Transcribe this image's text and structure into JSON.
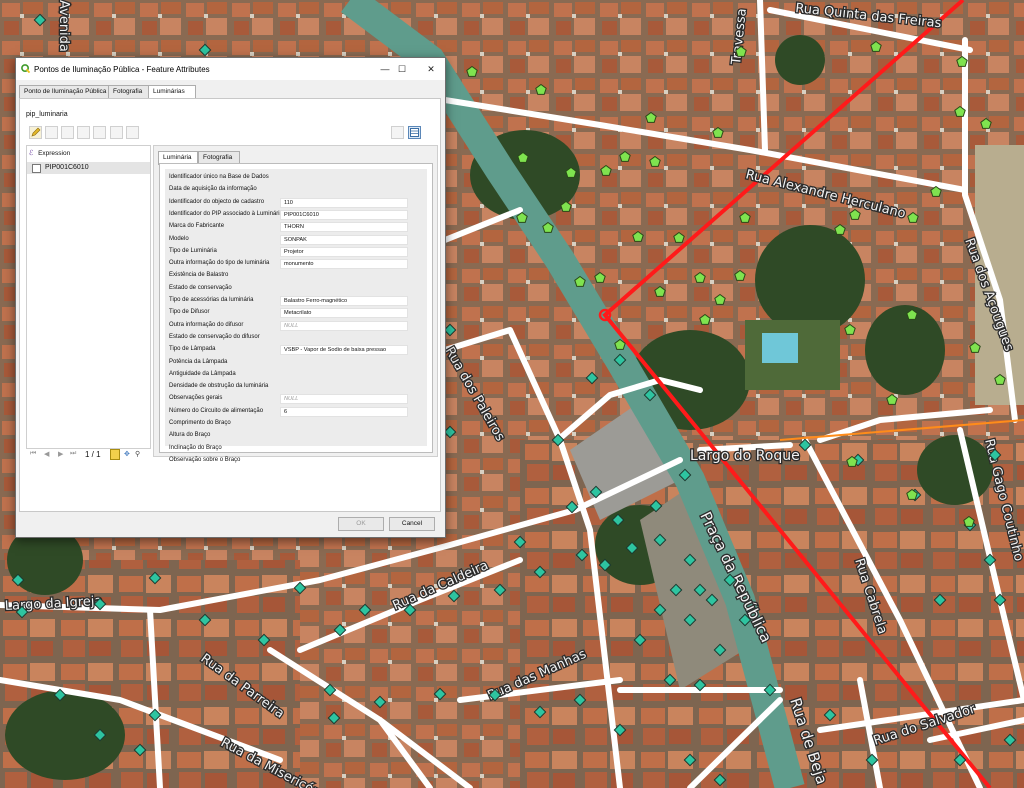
{
  "window": {
    "title": "Pontos de Iluminação Pública - Feature Attributes",
    "minimize": "—",
    "maximize": "☐",
    "close": "✕"
  },
  "tabs": [
    {
      "label": "Ponto de Iluminação Pública"
    },
    {
      "label": "Fotografia"
    },
    {
      "label": "Luminárias",
      "active": true
    }
  ],
  "layer_name": "pip_luminaria",
  "left_pane": {
    "expression_label": "Expression",
    "features": [
      "PIP001C6010"
    ]
  },
  "navigation": {
    "counter": "1 / 1"
  },
  "inner_tabs": [
    {
      "label": "Luminária",
      "active": true
    },
    {
      "label": "Fotografia"
    }
  ],
  "fields": [
    {
      "label": "Identificador único na Base de Dados",
      "value": null
    },
    {
      "label": "Data de aquisição da informação",
      "value": null
    },
    {
      "label": "Identificador do objecto de cadastro",
      "value": "110"
    },
    {
      "label": "Identificador do PIP associado à Luminária",
      "value": "PIP001C6010"
    },
    {
      "label": "Marca do Fabricante",
      "value": "THORN"
    },
    {
      "label": "Modelo",
      "value": "SONPAK"
    },
    {
      "label": "Tipo de Luminária",
      "value": "Projetor"
    },
    {
      "label": "Outra informação do tipo de luminária",
      "value": "monumento"
    },
    {
      "label": "Existência de Balastro",
      "value": null
    },
    {
      "label": "Estado de conservação",
      "value": null
    },
    {
      "label": "Tipo de acessórias da luminária",
      "value": "Balastro Ferro-magnético"
    },
    {
      "label": "Tipo de Difusor",
      "value": "Metacrilato"
    },
    {
      "label": "Outra informação do difusor",
      "value": "NULL"
    },
    {
      "label": "Estado de conservação do difusor",
      "value": null
    },
    {
      "label": "Tipo de Lâmpada",
      "value": "VSBP - Vapor de Sodio de baixa pressao"
    },
    {
      "label": "Potência da Lâmpada",
      "value": null
    },
    {
      "label": "Antiguidade da Lâmpada",
      "value": null
    },
    {
      "label": "Densidade de obstrução da luminária",
      "value": null
    },
    {
      "label": "Observações gerais",
      "value": "NULL"
    },
    {
      "label": "Número do Circuito de alimentação",
      "value": "6"
    },
    {
      "label": "Comprimento do Braço",
      "value": null
    },
    {
      "label": "Altura do Braço",
      "value": null
    },
    {
      "label": "Inclinação do Braço",
      "value": null
    },
    {
      "label": "Observação sobre o Braço",
      "value": null
    }
  ],
  "buttons": {
    "ok": "OK",
    "cancel": "Cancel"
  },
  "map": {
    "street_labels": [
      "Rua Quinta das Freiras",
      "Rua Alexandre Herculano",
      "Largo do Roque",
      "Praça da República",
      "Rua de Beja",
      "Rua da Caldeira",
      "Rua da Parreira",
      "Rua das Manhas",
      "Largo da Igreja",
      "Rua da Misericórdia",
      "Rua do Salvador",
      "Rua Gago Coutinho",
      "Rua dos Açougues",
      "Rua Cabrela",
      "Rua dos Paleiros",
      "Avenida",
      "Travessa"
    ],
    "colors": {
      "road": "#ffffff",
      "road_teal": "#5f9c8c",
      "selection_line": "#ff1a1a",
      "point_teal": "#2ec4a0",
      "point_green": "#7fe34f",
      "boundary": "#ff8c1a"
    }
  }
}
